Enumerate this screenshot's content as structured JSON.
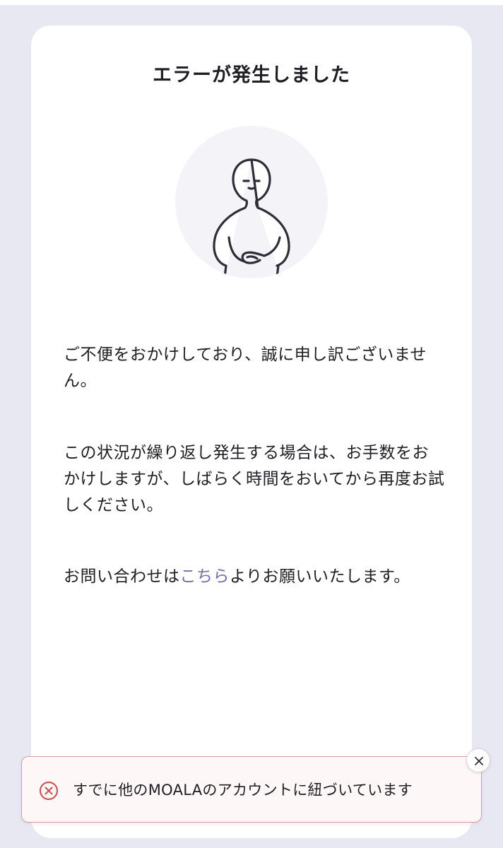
{
  "page": {
    "title": "エラーが発生しました",
    "illustration_icon": "bowing-person-icon",
    "paragraph1": "ご不便をおかけしており、誠に申し訳ございません。",
    "paragraph2": "この状況が繰り返し発生する場合は、お手数をおかけしますが、しばらく時間をおいてから再度お試しください。",
    "paragraph3_before": "お問い合わせは",
    "paragraph3_link": "こちら",
    "paragraph3_after": "よりお願いいたします。"
  },
  "toast": {
    "message": "すでに他のMOALAのアカウントに紐づいています",
    "icon": "error-circle-icon",
    "close_icon": "close-icon"
  },
  "colors": {
    "background": "#e8e8f2",
    "card": "#ffffff",
    "link": "#6f6fa8",
    "toast_border": "#d99b9b",
    "error_icon": "#c75a5a"
  }
}
